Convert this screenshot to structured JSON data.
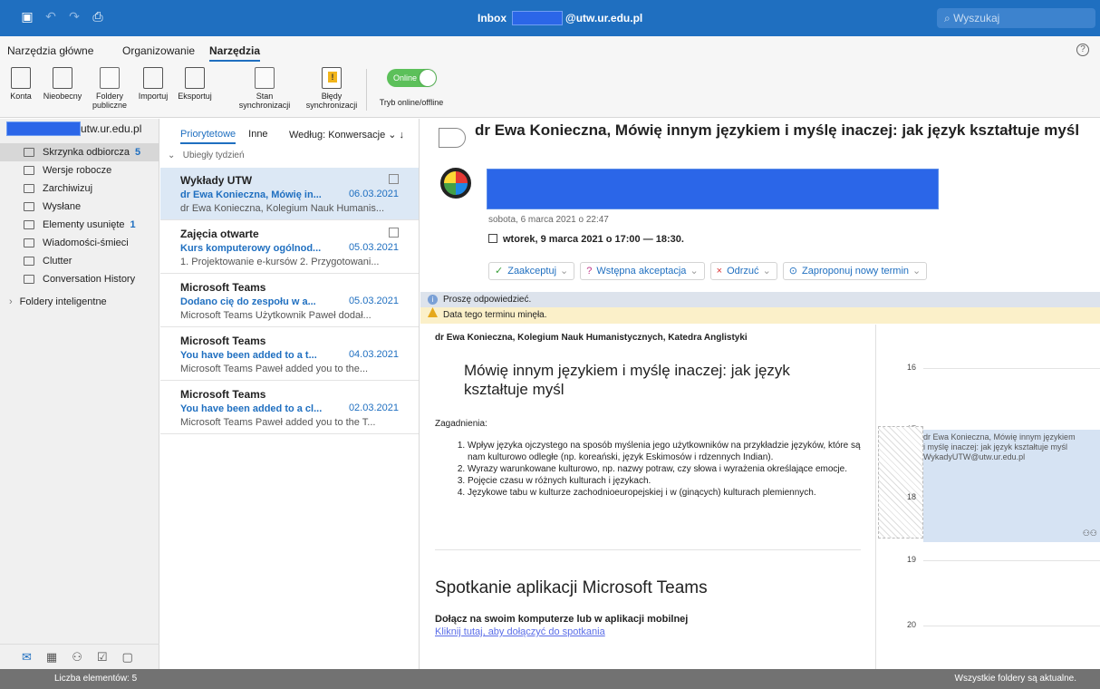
{
  "titlebar": {
    "title_prefix": "Inbox",
    "title_suffix": "@utw.ur.edu.pl",
    "search_placeholder": "Wyszukaj"
  },
  "ribbon": {
    "tabs": [
      "Narzędzia główne",
      "Organizowanie",
      "Narzędzia"
    ],
    "active_tab": "Narzędzia",
    "buttons": [
      {
        "line1": "Konta",
        "line2": "",
        "icon": "account-icon"
      },
      {
        "line1": "Nieobecny",
        "line2": "",
        "icon": "out-of-office-icon"
      },
      {
        "line1": "Foldery",
        "line2": "publiczne",
        "icon": "public-folders-icon"
      },
      {
        "line1": "Importuj",
        "line2": "",
        "icon": "import-icon"
      },
      {
        "line1": "Eksportuj",
        "line2": "",
        "icon": "export-icon"
      },
      {
        "line1": "Stan",
        "line2": "synchronizacji",
        "icon": "sync-status-icon"
      },
      {
        "line1": "Błędy",
        "line2": "synchronizacji",
        "icon": "sync-errors-icon"
      }
    ],
    "toggle_label": "Online",
    "toggle_caption": "Tryb online/offline"
  },
  "folders": {
    "account_suffix": "utw.ur.edu.pl",
    "items": [
      {
        "label": "Skrzynka odbiorcza",
        "count": "5",
        "icon": "inbox-icon"
      },
      {
        "label": "Wersje robocze",
        "count": "",
        "icon": "drafts-icon"
      },
      {
        "label": "Zarchiwizuj",
        "count": "",
        "icon": "archive-icon"
      },
      {
        "label": "Wysłane",
        "count": "",
        "icon": "sent-icon"
      },
      {
        "label": "Elementy usunięte",
        "count": "1",
        "icon": "trash-icon"
      },
      {
        "label": "Wiadomości-śmieci",
        "count": "",
        "icon": "junk-icon"
      },
      {
        "label": "Clutter",
        "count": "",
        "icon": "folder-icon"
      },
      {
        "label": "Conversation History",
        "count": "",
        "icon": "folder-icon"
      }
    ],
    "smart": "Foldery inteligentne"
  },
  "list": {
    "tabs": [
      "Priorytetowe",
      "Inne"
    ],
    "sort": "Według: Konwersacje",
    "group": "Ubiegły tydzień",
    "messages": [
      {
        "from": "Wykłady UTW",
        "subject": "dr Ewa Konieczna, Mówię in...",
        "date": "06.03.2021",
        "preview": "dr Ewa Konieczna, Kolegium Nauk Humanis..."
      },
      {
        "from": "Zajęcia otwarte",
        "subject": "Kurs komputerowy ogólnod...",
        "date": "05.03.2021",
        "preview": "1. Projektowanie e-kursów 2. Przygotowani..."
      },
      {
        "from": "Microsoft Teams",
        "subject": "Dodano cię do zespołu w a...",
        "date": "05.03.2021",
        "preview": "Microsoft Teams Użytkownik Paweł dodał..."
      },
      {
        "from": "Microsoft Teams",
        "subject": "You have been added to a t...",
        "date": "04.03.2021",
        "preview": "Microsoft Teams Paweł added you to the..."
      },
      {
        "from": "Microsoft Teams",
        "subject": "You have been added to a cl...",
        "date": "02.03.2021",
        "preview": "Microsoft Teams Paweł added you to the T..."
      }
    ]
  },
  "reading": {
    "subject": "dr Ewa Konieczna, Mówię innym językiem i myślę inaczej: jak język kształtuje myśl",
    "sent": "sobota, 6 marca 2021 o 22:47",
    "when": "wtorek, 9 marca 2021 o 17:00 — 18:30.",
    "actions": [
      "Zaakceptuj",
      "Wstępna akceptacja",
      "Odrzuć",
      "Zaproponuj nowy termin"
    ],
    "info": "Proszę odpowiedzieć.",
    "warning": "Data tego terminu minęła.",
    "author": "dr Ewa Konieczna, Kolegium Nauk Humanistycznych, Katedra Anglistyki",
    "heading": "Mówię innym językiem i myślę inaczej: jak język kształtuje myśl",
    "zagadnienia": "Zagadnienia:",
    "points": [
      "Wpływ języka ojczystego na sposób myślenia jego użytkowników na przykładzie języków, które są nam kulturowo odległe (np. koreański, język Eskimosów i rdzennych Indian).",
      "Wyrazy warunkowane kulturowo, np. nazwy potraw, czy słowa i wyrażenia określające emocje.",
      "Pojęcie czasu w różnych kulturach i językach.",
      "Językowe tabu w kulturze zachodnioeuropejskiej i w (ginących) kulturach plemiennych."
    ],
    "teams_title": "Spotkanie aplikacji Microsoft Teams",
    "teams_join": "Dołącz na swoim komputerze lub w aplikacji mobilnej",
    "teams_link": "Kliknij tutaj, aby dołączyć do spotkania"
  },
  "calendar": {
    "hours": [
      "16",
      "17",
      "18",
      "19",
      "20"
    ],
    "event_line1": "dr Ewa Konieczna, Mówię innym językiem",
    "event_line2": "i myślę inaczej: jak język kształtuje myśl",
    "event_line3": "WykadyUTW@utw.ur.edu.pl"
  },
  "status": {
    "left": "Liczba elementów: 5",
    "right": "Wszystkie foldery są aktualne."
  },
  "colors": {
    "accent": "#1f6fc0",
    "redaction": "#2b66e8"
  }
}
